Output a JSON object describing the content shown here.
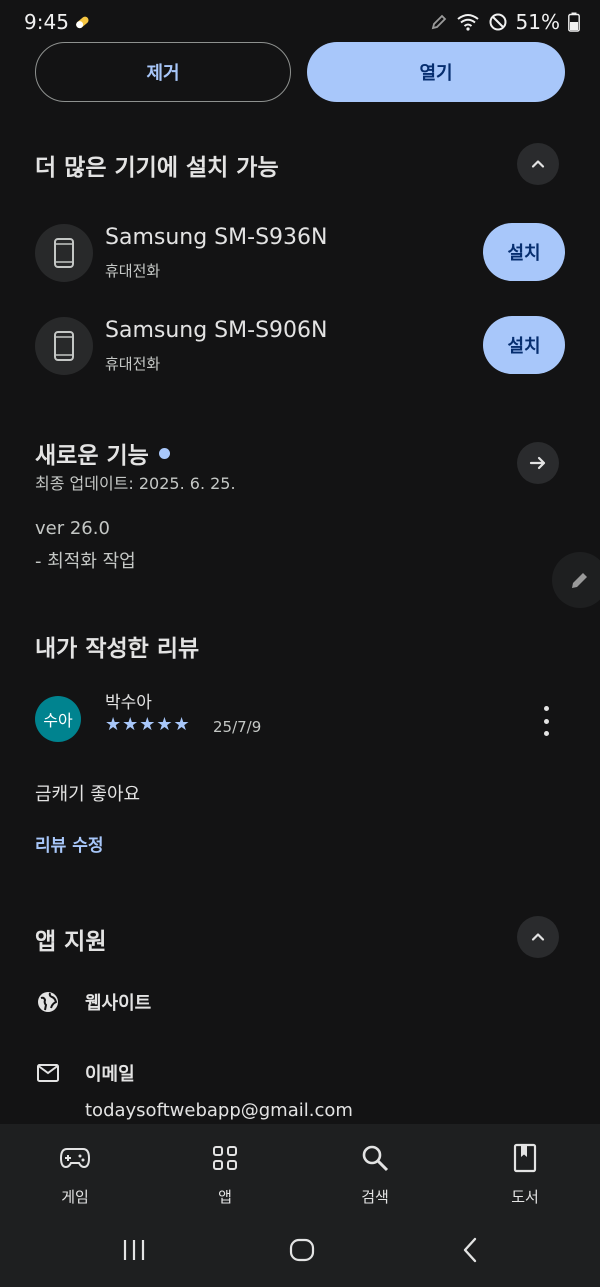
{
  "status_bar": {
    "time": "9:45",
    "battery": "51%"
  },
  "actions": {
    "remove_label": "제거",
    "open_label": "열기"
  },
  "install_more": {
    "title": "더 많은 기기에 설치 가능",
    "devices": [
      {
        "name": "Samsung SM-S936N",
        "type": "휴대전화",
        "install_label": "설치"
      },
      {
        "name": "Samsung SM-S906N",
        "type": "휴대전화",
        "install_label": "설치"
      }
    ]
  },
  "whats_new": {
    "title": "새로운 기능",
    "updated": "최종 업데이트: 2025. 6. 25.",
    "version": "ver 26.0",
    "notes": "- 최적화 작업"
  },
  "my_review": {
    "title": "내가 작성한 리뷰",
    "avatar_text": "수아",
    "reviewer": "박수아",
    "stars": "★★★★★",
    "rating": 5,
    "date": "25/7/9",
    "text": "금캐기 좋아요",
    "edit_label": "리뷰 수정"
  },
  "app_support": {
    "title": "앱 지원",
    "website_label": "웹사이트",
    "email_label": "이메일",
    "email_value": "todaysoftwebapp@gmail.com"
  },
  "bottom_nav": {
    "games": "게임",
    "apps": "앱",
    "search": "검색",
    "books": "도서"
  },
  "colors": {
    "background": "#131314",
    "accent": "#a8c7fa",
    "avatar": "#00838f"
  }
}
